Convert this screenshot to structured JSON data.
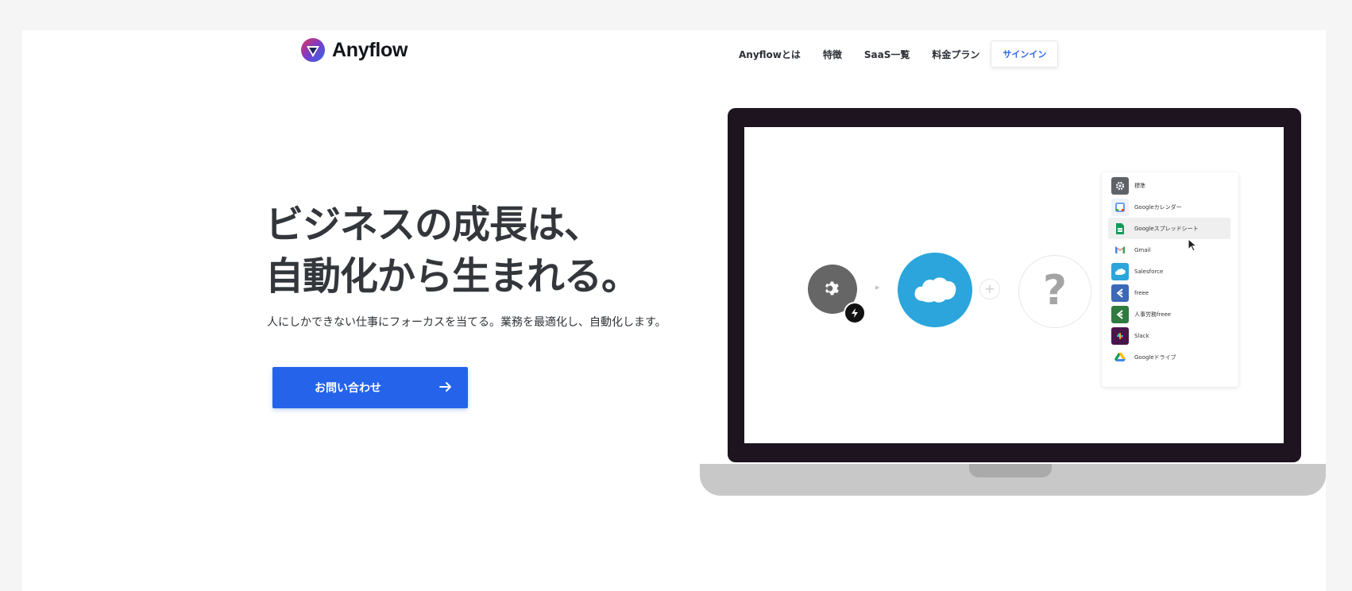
{
  "header": {
    "logo_text": "Anyflow",
    "nav": [
      "Anyflowとは",
      "特徴",
      "SaaS一覧",
      "料金プラン"
    ],
    "signin_label": "サインイン"
  },
  "hero": {
    "title_line1": "ビジネスの成長は、",
    "title_line2": "自動化から生まれる。",
    "subtitle": "人にしかできない仕事にフォーカスを当てる。業務を最適化し、自動化します。",
    "cta_label": "お問い合わせ"
  },
  "illustration": {
    "question_mark": "?",
    "plus": "+",
    "apps": [
      "標準",
      "Googleカレンダー",
      "Googleスプレッドシート",
      "Gmail",
      "Salesforce",
      "freee",
      "人事労務freee",
      "Slack",
      "Googleドライブ"
    ],
    "active_app_index": 2
  },
  "colors": {
    "primary": "#2563eb",
    "salesforce": "#2ba5dc",
    "laptop_frame": "#1e1420"
  }
}
